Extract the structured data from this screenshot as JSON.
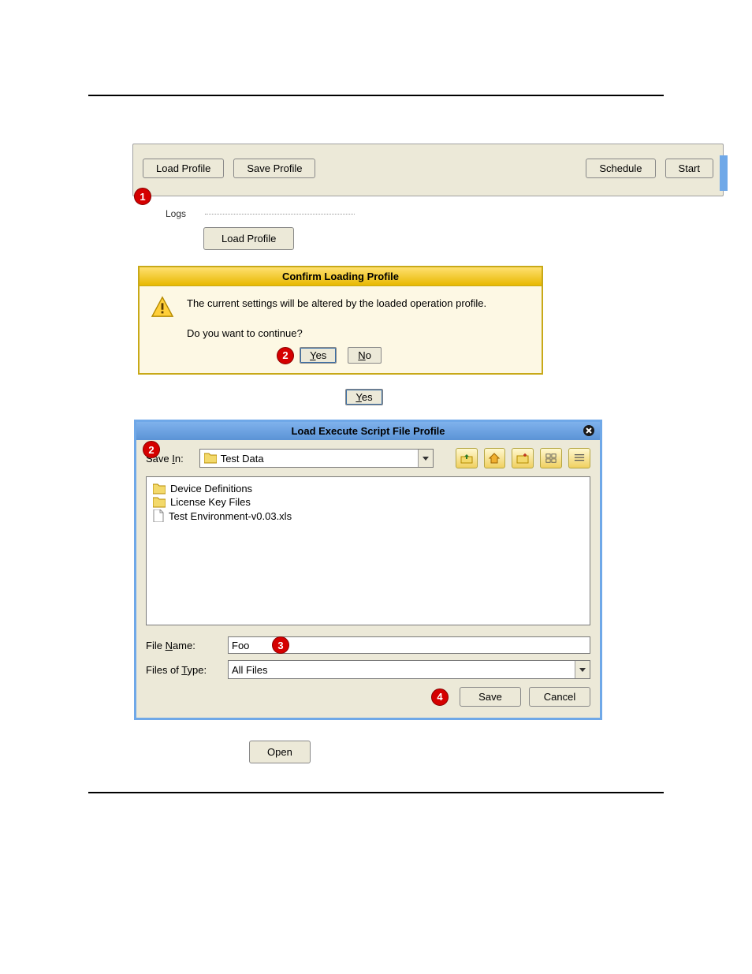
{
  "topbar": {
    "load_profile": "Load Profile",
    "save_profile": "Save Profile",
    "schedule": "Schedule",
    "start": "Start"
  },
  "logs_label": "Logs",
  "standalone": {
    "load_profile": "Load Profile",
    "yes": "Yes",
    "open": "Open"
  },
  "callouts": {
    "c1": "1",
    "c2": "2",
    "c2b": "2",
    "c3": "3",
    "c4": "4"
  },
  "confirm": {
    "title": "Confirm Loading Profile",
    "line1": "The current settings will be altered by the loaded operation profile.",
    "line2": "Do you want to continue?",
    "yes_u": "Y",
    "yes_rest": "es",
    "no_u": "N",
    "no_rest": "o"
  },
  "filedlg": {
    "title": "Load Execute Script File Profile",
    "save_in_pre": "Save ",
    "save_in_u": "I",
    "save_in_post": "n:",
    "save_in_value": "Test Data",
    "items": [
      {
        "type": "folder",
        "name": "Device Definitions"
      },
      {
        "type": "folder",
        "name": "License Key Files"
      },
      {
        "type": "file",
        "name": "Test Environment-v0.03.xls"
      }
    ],
    "file_name_pre": "File ",
    "file_name_u": "N",
    "file_name_post": "ame:",
    "file_name_value": "Foo",
    "files_type_pre": "Files of ",
    "files_type_u": "T",
    "files_type_post": "ype:",
    "files_type_value": "All Files",
    "save": "Save",
    "cancel": "Cancel"
  }
}
